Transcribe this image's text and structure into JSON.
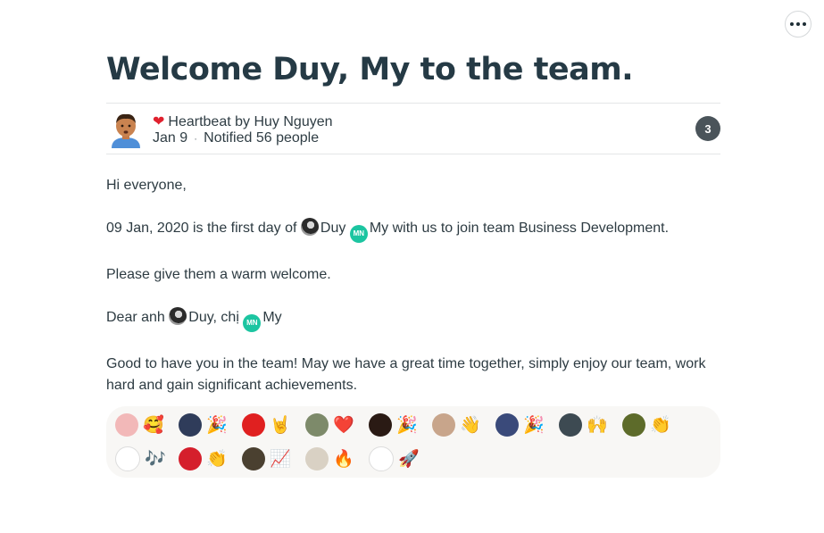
{
  "post": {
    "title": "Welcome Duy, My to the team.",
    "author_line": "Heartbeat by Huy Nguyen",
    "heart_icon": "heart-icon",
    "date": "Jan 9",
    "notified": "Notified 56 people",
    "comment_count": "3"
  },
  "body": {
    "greeting": "Hi everyone,",
    "line2_prefix": "09 Jan, 2020 is the first day of ",
    "mention_duy": "Duy",
    "mention_my": "My",
    "my_initials": "MN",
    "line2_suffix": " with us to join team Business Development.",
    "line3": "Please give them a warm welcome.",
    "line4_prefix": "Dear anh ",
    "line4_mid": ", chị ",
    "line5": "Good to have you in the team! May we have a great time together, simply enjoy our team, work hard and gain significant achievements."
  },
  "reactions": [
    {
      "emoji": "🥰",
      "avatar_color": "#f2b8b8"
    },
    {
      "emoji": "🎉",
      "avatar_color": "#2f3c5a"
    },
    {
      "emoji": "🤘",
      "avatar_color": "#e02020"
    },
    {
      "emoji": "❤️",
      "avatar_color": "#7d8a6a"
    },
    {
      "emoji": "🎉",
      "avatar_color": "#2a1a14"
    },
    {
      "emoji": "👋",
      "avatar_color": "#c8a58b"
    },
    {
      "emoji": "🎉",
      "avatar_color": "#3a4a7a"
    },
    {
      "emoji": "🙌",
      "avatar_color": "#3d4a52"
    },
    {
      "emoji": "👏",
      "avatar_color": "#5d6b2a"
    },
    {
      "emoji": "🎶",
      "avatar_color": "#ffffff"
    },
    {
      "emoji": "👏",
      "avatar_color": "#d51f2c"
    },
    {
      "emoji": "📈",
      "avatar_color": "#4a4030"
    },
    {
      "emoji": "🔥",
      "avatar_color": "#d9d1c4"
    },
    {
      "emoji": "🚀",
      "avatar_color": "#ffffff"
    }
  ],
  "colors": {
    "title": "#253a45",
    "text": "#2d3b42",
    "badge": "#4a545a",
    "reaction_bg": "#f8f7f5",
    "mention_my": "#1cc5a1"
  }
}
